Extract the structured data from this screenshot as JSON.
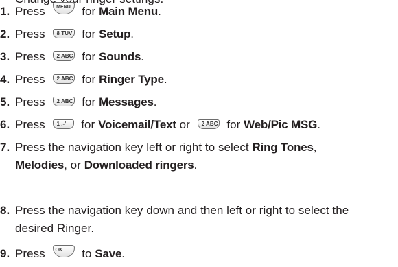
{
  "intro": "Change your ringer settings.",
  "steps": [
    {
      "num": "1.",
      "pre": "Press",
      "key": "MENU",
      "mid": "for",
      "bold": "Main Menu",
      "post": "."
    },
    {
      "num": "2.",
      "pre": "Press",
      "key": "8 TUV",
      "mid": "for",
      "bold": "Setup",
      "post": "."
    },
    {
      "num": "3.",
      "pre": "Press",
      "key": "2 ABC",
      "mid": "for",
      "bold": "Sounds",
      "post": "."
    },
    {
      "num": "4.",
      "pre": "Press",
      "key": "2 ABC",
      "mid": "for",
      "bold": "Ringer Type",
      "post": "."
    },
    {
      "num": "5.",
      "pre": "Press",
      "key": "2 ABC",
      "mid": "for",
      "bold": "Messages",
      "post": "."
    },
    {
      "num": "6.",
      "pre": "Press",
      "key": "1 .-'",
      "mid": "for",
      "bold": "Voicemail/Text",
      "or": "or",
      "key2": "2 ABC",
      "mid2": "for",
      "bold2": "Web/Pic MSG",
      "post": "."
    },
    {
      "num": "7.",
      "line1": "Press the navigation key left or right to select",
      "bold_a": "Ring Tones",
      "comma": ",",
      "bold_b": "Melodies",
      "or": ", or",
      "bold_c": "Downloaded ringers",
      "post": "."
    },
    {
      "num": "8.",
      "line1": "Press the navigation key down and then left or right to select the",
      "line2": "desired Ringer."
    },
    {
      "num": "9.",
      "pre": "Press",
      "key": "OK",
      "mid": "to",
      "bold": "Save",
      "post": "."
    }
  ]
}
